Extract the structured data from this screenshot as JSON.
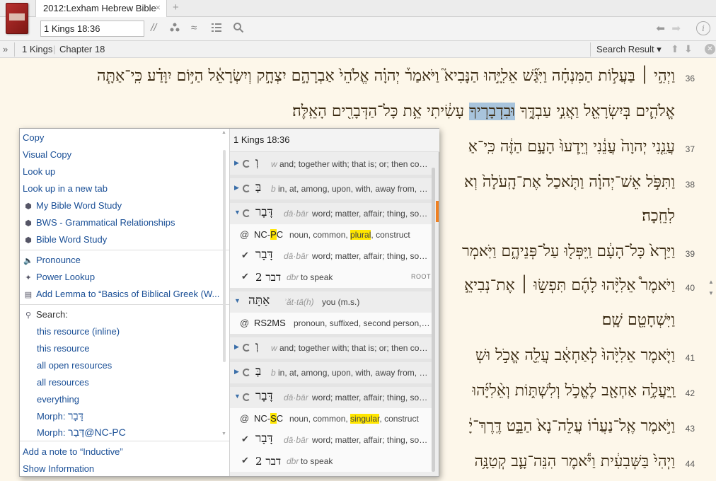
{
  "tab": {
    "title": "2012:Lexham Hebrew Bible",
    "close": "×",
    "new": "+"
  },
  "toolbar": {
    "reference_value": "1 Kings 18:36",
    "parallel_icon": "//",
    "visual_filter_icon": "≈"
  },
  "crumbs": {
    "expand": "»",
    "book": "1 Kings",
    "chapter": "Chapter 18",
    "search_result": "Search Result ▾"
  },
  "verses": [
    {
      "num": "36",
      "lines": [
        "וַיְהִ֣י ׀ בַּעֲל֣וֹת הַמִּנְחָ֗ה וַיִּגַּ֞שׁ אֵלִיָּ֣הוּ הַנָּבִיא֮ וַיֹּאמַר֒ יְהוָ֗ה אֱלֹהֵי֙ אַבְרָהָ֣ם יִצְחָ֣ק וְיִשְׂרָאֵ֔ל הַיּ֣וֹם יִוָּדַ֗ע כִּֽי־אַתָּ֧ה",
        "אֱלֹהִ֛ים בְּיִשְׂרָאֵ֖ל וַאֲנִ֣י עַבְדֶּ֑ךָ"
      ],
      "highlight": "וּבִדְבָרְיךָ",
      "tail": "עָשִׂ֔יתִי אֵ֥ת כָּל־הַדְּבָרִ֖ים הָאֵֽלֶּה׃"
    },
    {
      "num": "37",
      "text": "עֲנֵ֤נִי יְהוָה֙ עֲנֵ֔נִי וְיֵֽדְעוּ֙ הָעָ֣ם הַזֶּ֔ה כִּֽי־אַ"
    },
    {
      "num": "38",
      "text": "וַתִּפֹּ֣ל אֵשׁ־יְהוָ֗ה וַתֹּ֤אכַל אֶת־הָֽעֹלָה֙ וְא",
      "cont": "לִחֵֽכָה׃"
    },
    {
      "num": "39",
      "text": "וַיַּרְא֙ כָּל־הָעָ֔ם וַֽיִּפְּל֖וּ עַל־פְּנֵיהֶ֑ם וַיֹּֽאמְר"
    },
    {
      "num": "40",
      "text": "וַיֹּאמֶר֩ אֵלִיָּ֨הוּ לָהֶ֜ם תִּפְשׂ֣וּ ׀ אֶת־נְבִיאֵ֣",
      "cont": "וַיִּשְׁחָטֵ֖ם שָֽׁם׃"
    },
    {
      "num": "41",
      "text": "וַיֹּ֤אמֶר אֵלִיָּ֙הוּ֙ לְאַחְאָ֔ב עֲלֵ֖ה אֱכֹ֣ל וּשְׁ"
    },
    {
      "num": "42",
      "text": "וַֽיַּעֲלֶ֥ה אַחְאָ֖ב לֶאֱכֹ֣ל וְלִשְׁתּ֑וֹת וְאֵ֨לִיָּ֜הוּ"
    },
    {
      "num": "43",
      "text": "וַיֹּ֣אמֶר אֶֽל־נַעֲר֗וֹ עֲלֵה־נָא֙ הַבֵּ֣ט דֶּֽרֶךְ־יָ֔"
    },
    {
      "num": "44",
      "text": "וַיְהִי֙ בַּשְּׁבִעִ֔ית וַיֹּ֕אמֶר הִנֵּה־עָ֛ב קְטַנָּ֥ה"
    }
  ],
  "menu": {
    "copy": "Copy",
    "visual_copy": "Visual Copy",
    "look_up": "Look up",
    "look_up_new_tab": "Look up in a new tab",
    "my_bws": "My Bible Word Study",
    "bws_gram": "BWS - Grammatical Relationships",
    "bws": "Bible Word Study",
    "pronounce": "Pronounce",
    "power_lookup": "Power Lookup",
    "add_lemma": "Add Lemma to “Basics of Biblical Greek (W...",
    "search": "Search:",
    "search_items": [
      "this resource (inline)",
      "this resource",
      "all open resources",
      "all resources",
      "everything"
    ],
    "morph1_label": "Morph:",
    "morph1_value": "דָּבָר",
    "morph2_label": "Morph:",
    "morph2_value": "דָּבָר@NC-PC",
    "add_note": "Add a note to “Inductive”",
    "show_info": "Show Information"
  },
  "panel": {
    "title": "1 Kings 18:36",
    "rows": [
      {
        "type": "word",
        "expanded": false,
        "heb": "וְ",
        "translit": "w",
        "gloss": "and; together with; that is; or; then conju..."
      },
      {
        "type": "word",
        "expanded": false,
        "heb": "בְּ",
        "translit": "b",
        "gloss": "in, at, among, upon, with, away from, wh..."
      },
      {
        "type": "word",
        "expanded": true,
        "heb": "דָּבָר",
        "translit": "dā·bār",
        "gloss": "word; matter, affair; thing, some..."
      },
      {
        "type": "morph",
        "code_pre": "NC-",
        "code_hl": "P",
        "code_post": "C",
        "desc_pre": "noun, common, ",
        "desc_hl": "plural",
        "desc_post": ", construct"
      },
      {
        "type": "lemma",
        "heb": "דָּבָר",
        "translit": "dā·bār",
        "gloss": "word; matter, affair; thing, some..."
      },
      {
        "type": "root",
        "heb": "דבר 2",
        "translit": "dbr",
        "gloss": "to speak",
        "badge": "ROOT"
      },
      {
        "type": "word",
        "expanded": true,
        "heb": "אַתָּה",
        "translit": "ʾăt·tā(h)",
        "gloss": "you (m.s.)"
      },
      {
        "type": "morph",
        "code_pre": "RS2MS",
        "code_hl": "",
        "code_post": "",
        "desc_pre": "pronoun, suffixed, second person, m...",
        "desc_hl": "",
        "desc_post": ""
      },
      {
        "type": "word",
        "expanded": false,
        "heb": "וְ",
        "translit": "w",
        "gloss": "and; together with; that is; or; then conju..."
      },
      {
        "type": "word",
        "expanded": false,
        "heb": "בְּ",
        "translit": "b",
        "gloss": "in, at, among, upon, with, away from, wh..."
      },
      {
        "type": "word",
        "expanded": true,
        "heb": "דָּבָר",
        "translit": "dā·bār",
        "gloss": "word; matter, affair; thing, some..."
      },
      {
        "type": "morph",
        "code_pre": "NC-",
        "code_hl": "S",
        "code_post": "C",
        "desc_pre": "noun, common, ",
        "desc_hl": "singular",
        "desc_post": ", construct"
      },
      {
        "type": "lemma",
        "heb": "דָּבָר",
        "translit": "dā·bār",
        "gloss": "word; matter, affair; thing, some..."
      },
      {
        "type": "root",
        "heb": "דבר 2",
        "translit": "dbr",
        "gloss": "to speak",
        "badge": ""
      }
    ]
  },
  "colors": {
    "menu_link": "#1a4f96",
    "highlight_yellow": "#ffe600",
    "selection_blue": "#a8c4dc",
    "accent_orange": "#f08020"
  }
}
